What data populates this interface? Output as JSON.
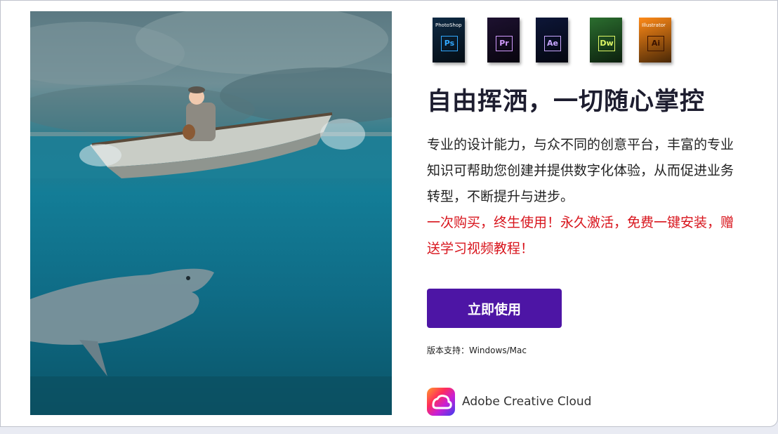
{
  "products": [
    {
      "caption": "PhotoShop",
      "abbr": "Ps",
      "bg": "#0e2a44",
      "fg": "#31a8ff"
    },
    {
      "caption": "",
      "abbr": "Pr",
      "bg": "#1d1130",
      "fg": "#d29bff"
    },
    {
      "caption": "",
      "abbr": "Ae",
      "bg": "#0d1638",
      "fg": "#c8a6ff"
    },
    {
      "caption": "",
      "abbr": "Dw",
      "bg": "#2b6e2f",
      "fg": "#dff766"
    },
    {
      "caption": "Illustrator",
      "abbr": "Ai",
      "bg": "#ff8a17",
      "fg": "#3b1300"
    }
  ],
  "headline": "自由挥洒，一切随心掌控",
  "description": "专业的设计能力，与众不同的创意平台，丰富的专业知识可帮助您创建并提供数字化体验，从而促进业务转型，不断提升与进步。",
  "promo": "一次购买，终生使用！永久激活，免费一键安装，赠送学习视频教程！",
  "cta_label": "立即使用",
  "version_support": "版本支持：Windows/Mac",
  "brand_label": "Adobe Creative Cloud",
  "colors": {
    "accent": "#4d15a5",
    "promo": "#d8141c",
    "title": "#1d1d2f"
  }
}
